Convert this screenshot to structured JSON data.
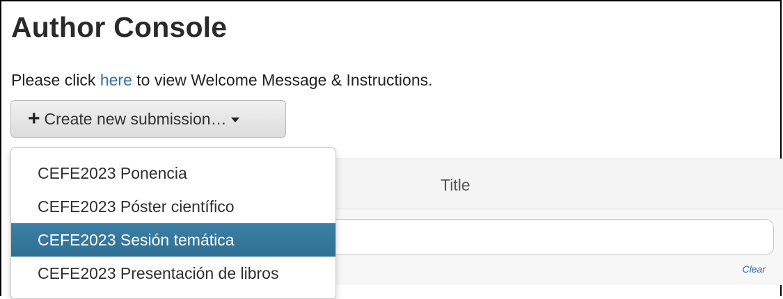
{
  "page": {
    "title": "Author Console"
  },
  "intro": {
    "prefix": "Please click ",
    "link_text": "here",
    "suffix": " to view Welcome Message & Instructions.",
    "link_color": "#2a6ea8"
  },
  "create_button": {
    "icon": "plus-icon",
    "label": "Create new submission…",
    "caret_icon": "caret-down-icon"
  },
  "submission_menu": {
    "items": [
      {
        "label": "CEFE2023 Ponencia",
        "active": false
      },
      {
        "label": "CEFE2023 Póster científico",
        "active": false
      },
      {
        "label": "CEFE2023 Sesión temática",
        "active": true
      },
      {
        "label": "CEFE2023 Presentación de libros",
        "active": false
      }
    ],
    "active_color": "#33729a"
  },
  "table": {
    "columns": [
      "Title"
    ],
    "title_filter_value": "",
    "clear_label": "Clear"
  }
}
